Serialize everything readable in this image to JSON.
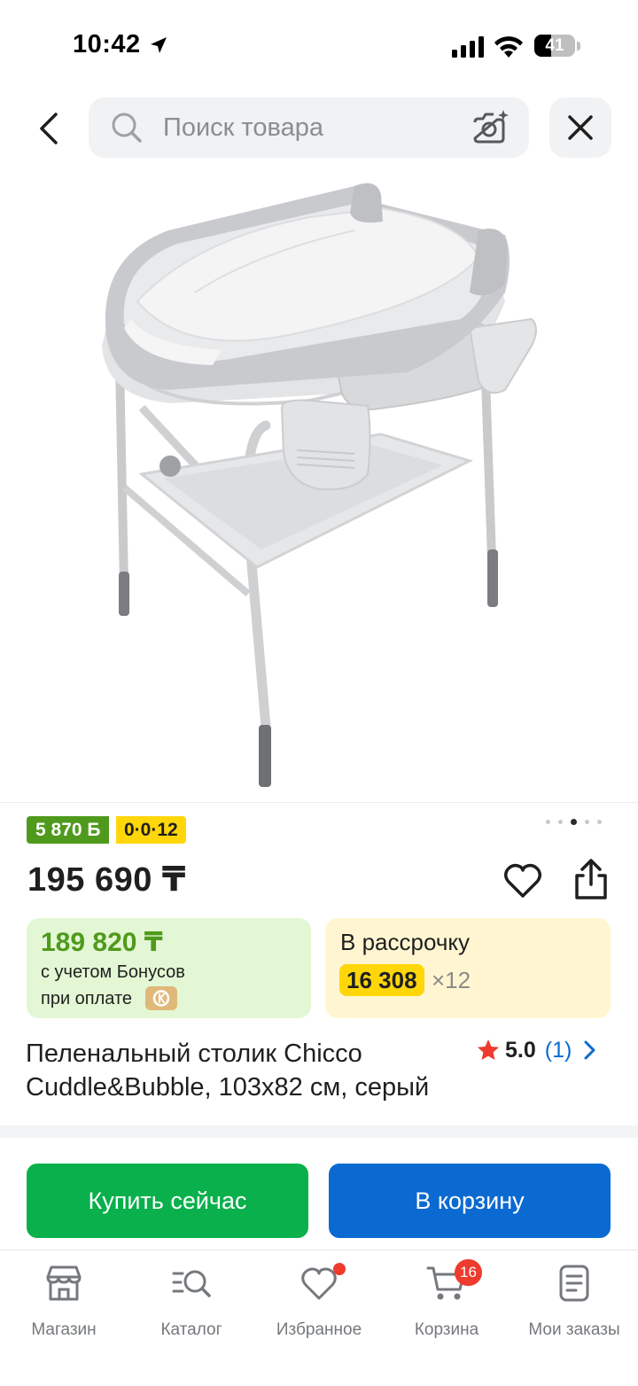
{
  "status_bar": {
    "time": "10:42",
    "battery": "41",
    "battery_level": 0.41
  },
  "search": {
    "placeholder": "Поиск товара"
  },
  "product": {
    "image_alt": "Пеленальный столик Chicco Cuddle&Bubble",
    "bonus_badge": "5 870 Б",
    "installment_badge": "0·0·12",
    "gallery": {
      "count": 5,
      "active": 2
    },
    "price": "195 690 ₸",
    "bonus_price": "189 820 ₸",
    "bonus_note_line1": "с учетом Бонусов",
    "bonus_note_line2": "при оплате",
    "installment_title": "В рассрочку",
    "installment_amount": "16 308",
    "installment_months": "×12",
    "title": "Пеленальный столик Chicco Cuddle&Bubble, 103x82 см, серый",
    "rating": "5.0",
    "rating_count": "(1)"
  },
  "actions": {
    "buy_now": "Купить сейчас",
    "add_to_cart": "В корзину"
  },
  "tabs": [
    {
      "label": "Магазин",
      "icon": "shop-icon"
    },
    {
      "label": "Каталог",
      "icon": "catalog-search-icon"
    },
    {
      "label": "Избранное",
      "icon": "heart-icon"
    },
    {
      "label": "Корзина",
      "icon": "cart-icon",
      "badge": "16"
    },
    {
      "label": "Мои заказы",
      "icon": "orders-icon"
    }
  ],
  "colors": {
    "green": "#09b04b",
    "blue": "#0b6ad1",
    "yellow": "#ffd60a",
    "badge_red": "#ee3b2e"
  }
}
